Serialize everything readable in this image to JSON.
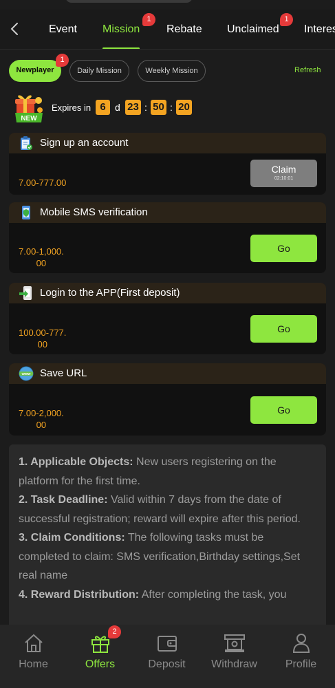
{
  "top_nav": {
    "tabs": [
      {
        "label": "Event"
      },
      {
        "label": "Mission",
        "badge": "1"
      },
      {
        "label": "Rebate"
      },
      {
        "label": "Unclaimed",
        "badge": "1"
      },
      {
        "label": "Interes"
      }
    ]
  },
  "filters": {
    "chips": [
      {
        "label": "Newplayer",
        "badge": "1"
      },
      {
        "label": "Daily Mission"
      },
      {
        "label": "Weekly Mission"
      }
    ],
    "refresh": "Refresh"
  },
  "expiry": {
    "label": "Expires in",
    "badge_text": "NEW",
    "days": "6",
    "day_unit": "d",
    "hours": "23",
    "minutes": "50",
    "seconds": "20",
    "sep": ":"
  },
  "missions": [
    {
      "title": "Sign up an account",
      "reward": "7.00-777.00",
      "button": "Claim",
      "timer": "02:10:01",
      "icon": "clipboard-check-icon"
    },
    {
      "title": "Mobile SMS verification",
      "reward_line1": "7.00-1,000.",
      "reward_line2": "00",
      "button": "Go",
      "icon": "phone-shield-icon"
    },
    {
      "title": "Login to the APP(First deposit)",
      "reward_line1": "100.00-777.",
      "reward_line2": "00",
      "button": "Go",
      "icon": "phone-arrow-icon"
    },
    {
      "title": "Save URL",
      "reward_line1": "7.00-2,000.",
      "reward_line2": "00",
      "button": "Go",
      "icon": "www-globe-icon"
    }
  ],
  "rules": [
    {
      "head": "1. Applicable Objects:",
      "body": " New users registering on the platform for the first time."
    },
    {
      "head": "2. Task Deadline:",
      "body": " Valid within 7 days from the date of successful registration; reward will expire after this period."
    },
    {
      "head": "3. Claim Conditions:",
      "body": " The following tasks must be completed to claim: SMS verification,Birthday settings,Set real name"
    },
    {
      "head": "4. Reward Distribution:",
      "body": " After completing the task, you"
    }
  ],
  "bottom_nav": {
    "items": [
      {
        "label": "Home",
        "icon": "home-icon"
      },
      {
        "label": "Offers",
        "icon": "gift-icon",
        "badge": "2"
      },
      {
        "label": "Deposit",
        "icon": "wallet-icon"
      },
      {
        "label": "Withdraw",
        "icon": "withdraw-icon"
      },
      {
        "label": "Profile",
        "icon": "profile-icon"
      }
    ]
  },
  "colors": {
    "accent": "#8ee63f",
    "timer": "#f3a422",
    "badge": "#e53a3a"
  }
}
